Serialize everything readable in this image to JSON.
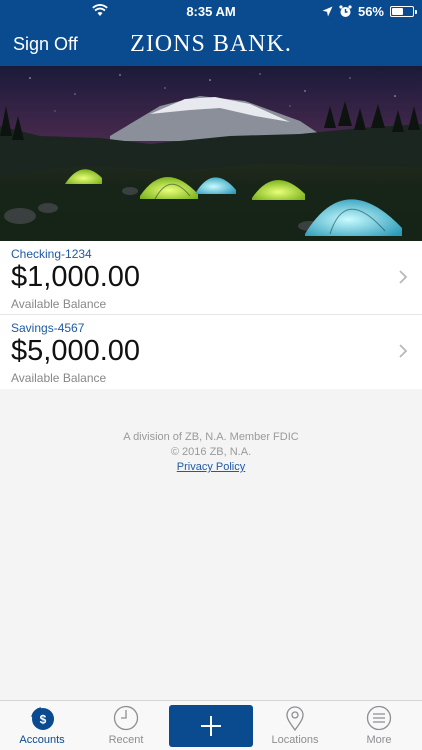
{
  "status_bar": {
    "time": "8:35 AM",
    "battery": "56%",
    "battery_level": 0.56
  },
  "nav": {
    "sign_off_label": "Sign Off",
    "brand": "ZIONS BANK."
  },
  "accounts": [
    {
      "name": "Checking-1234",
      "balance": "$1,000.00",
      "balance_label": "Available Balance"
    },
    {
      "name": "Savings-4567",
      "balance": "$5,000.00",
      "balance_label": "Available Balance"
    }
  ],
  "footer": {
    "line1": "A division of ZB, N.A. Member FDIC",
    "line2": "© 2016 ZB, N.A.",
    "privacy_link": "Privacy Policy"
  },
  "tabs": [
    {
      "label": "Accounts",
      "icon": "accounts-dollar-icon",
      "active": true
    },
    {
      "label": "Recent",
      "icon": "clock-icon",
      "active": false
    },
    {
      "label": "",
      "icon": "plus-icon",
      "active": false
    },
    {
      "label": "Locations",
      "icon": "location-pin-icon",
      "active": false
    },
    {
      "label": "More",
      "icon": "menu-icon",
      "active": false
    }
  ],
  "colors": {
    "brand_blue": "#0a4a8f",
    "link_blue": "#1e5aa8"
  }
}
